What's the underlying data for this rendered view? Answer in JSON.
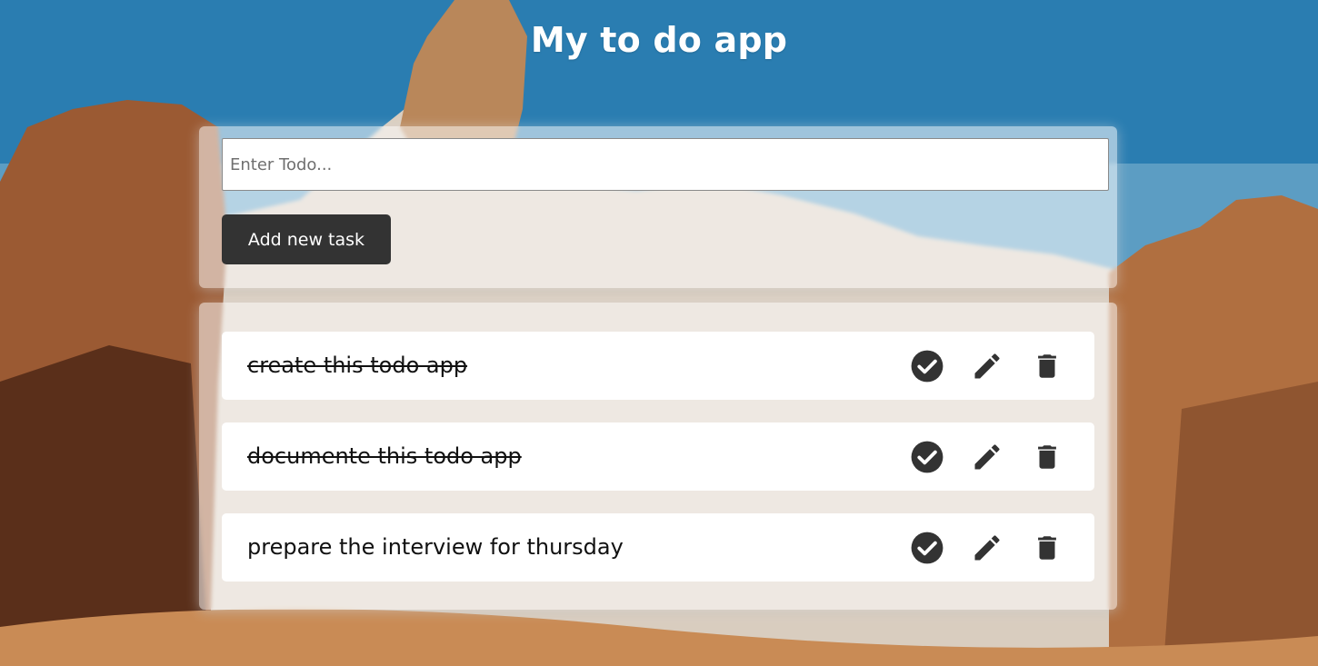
{
  "app": {
    "title": "My to do app"
  },
  "form": {
    "input_placeholder": "Enter Todo...",
    "input_value": "",
    "add_button_label": "Add new task"
  },
  "todos": [
    {
      "text": "create this todo app",
      "completed": true
    },
    {
      "text": "documente this todo app",
      "completed": true
    },
    {
      "text": "prepare the interview for thursday",
      "completed": false
    }
  ],
  "icons": {
    "complete": "check-circle-icon",
    "edit": "pencil-icon",
    "delete": "trash-icon"
  },
  "colors": {
    "button_bg": "#333333",
    "icon_color": "#333333",
    "title_color": "#ffffff"
  }
}
